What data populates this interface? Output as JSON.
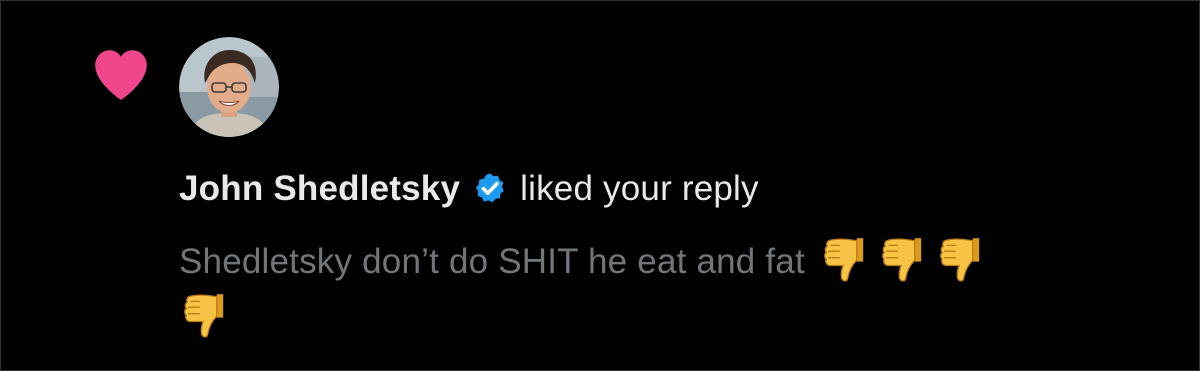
{
  "notification": {
    "type_icon": "heart-icon",
    "avatar_icon": "user-avatar",
    "user_name": "John Shedletsky",
    "verified_icon": "verified-badge-icon",
    "action_text": "liked your reply",
    "reply_text": "Shedletsky don’t do SHIT he eat and fat",
    "reply_emojis": [
      "thumbs-down",
      "thumbs-down",
      "thumbs-down",
      "thumbs-down"
    ]
  },
  "colors": {
    "background": "#000000",
    "heart": "#f91880",
    "verified": "#1d9bf0",
    "primary_text": "#e7e9ea",
    "secondary_text": "#71767b",
    "emoji": "#f2c230"
  }
}
